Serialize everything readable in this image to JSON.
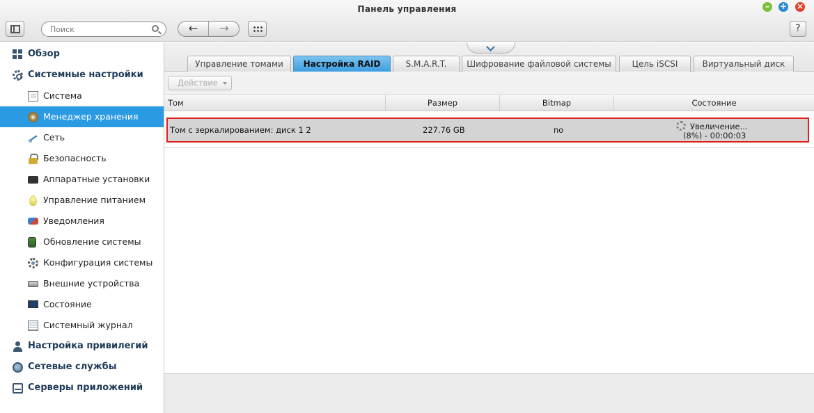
{
  "window": {
    "title": "Панель управления"
  },
  "toolbar": {
    "search_placeholder": "Поиск",
    "back_glyph": "←",
    "forward_glyph": "→",
    "help_label": "?"
  },
  "sidebar": {
    "items": [
      {
        "label": "Обзор",
        "icon": "overview-grid-icon",
        "level": "top"
      },
      {
        "label": "Системные настройки",
        "icon": "gear-icon",
        "level": "top"
      },
      {
        "label": "Система",
        "icon": "system-doc-icon",
        "level": "sub"
      },
      {
        "label": "Менеджер хранения",
        "icon": "storage-disk-icon",
        "level": "sub",
        "active": true
      },
      {
        "label": "Сеть",
        "icon": "network-icon",
        "level": "sub"
      },
      {
        "label": "Безопасность",
        "icon": "lock-icon",
        "level": "sub"
      },
      {
        "label": "Аппаратные установки",
        "icon": "hardware-icon",
        "level": "sub"
      },
      {
        "label": "Управление питанием",
        "icon": "bulb-icon",
        "level": "sub"
      },
      {
        "label": "Уведомления",
        "icon": "notification-icon",
        "level": "sub"
      },
      {
        "label": "Обновление системы",
        "icon": "firmware-update-icon",
        "level": "sub"
      },
      {
        "label": "Конфигурация системы",
        "icon": "config-gear-icon",
        "level": "sub"
      },
      {
        "label": "Внешние устройства",
        "icon": "external-device-icon",
        "level": "sub"
      },
      {
        "label": "Состояние",
        "icon": "monitor-icon",
        "level": "sub"
      },
      {
        "label": "Системный журнал",
        "icon": "log-icon",
        "level": "sub"
      },
      {
        "label": "Настройка привилегий",
        "icon": "person-icon",
        "level": "top"
      },
      {
        "label": "Сетевые службы",
        "icon": "globe-icon",
        "level": "top"
      },
      {
        "label": "Серверы приложений",
        "icon": "server-icon",
        "level": "top"
      }
    ]
  },
  "tabs": [
    {
      "label": "Управление томами"
    },
    {
      "label": "Настройка RAID",
      "active": true
    },
    {
      "label": "S.M.A.R.T."
    },
    {
      "label": "Шифрование файловой системы"
    },
    {
      "label": "Цель iSCSI"
    },
    {
      "label": "Виртуальный диск"
    }
  ],
  "actions": {
    "action_label": "Действие"
  },
  "table": {
    "columns": [
      "Том",
      "Размер",
      "Bitmap",
      "Состояние"
    ],
    "rows": [
      {
        "volume": "Том с зеркалированием: диск 1 2",
        "size": "227.76 GB",
        "bitmap": "no",
        "status_line1": "Увеличение...",
        "status_line2": "(8%) - 00:00:03"
      }
    ]
  },
  "colors": {
    "accent": "#2a9ae3",
    "highlight_border": "#e02020"
  }
}
